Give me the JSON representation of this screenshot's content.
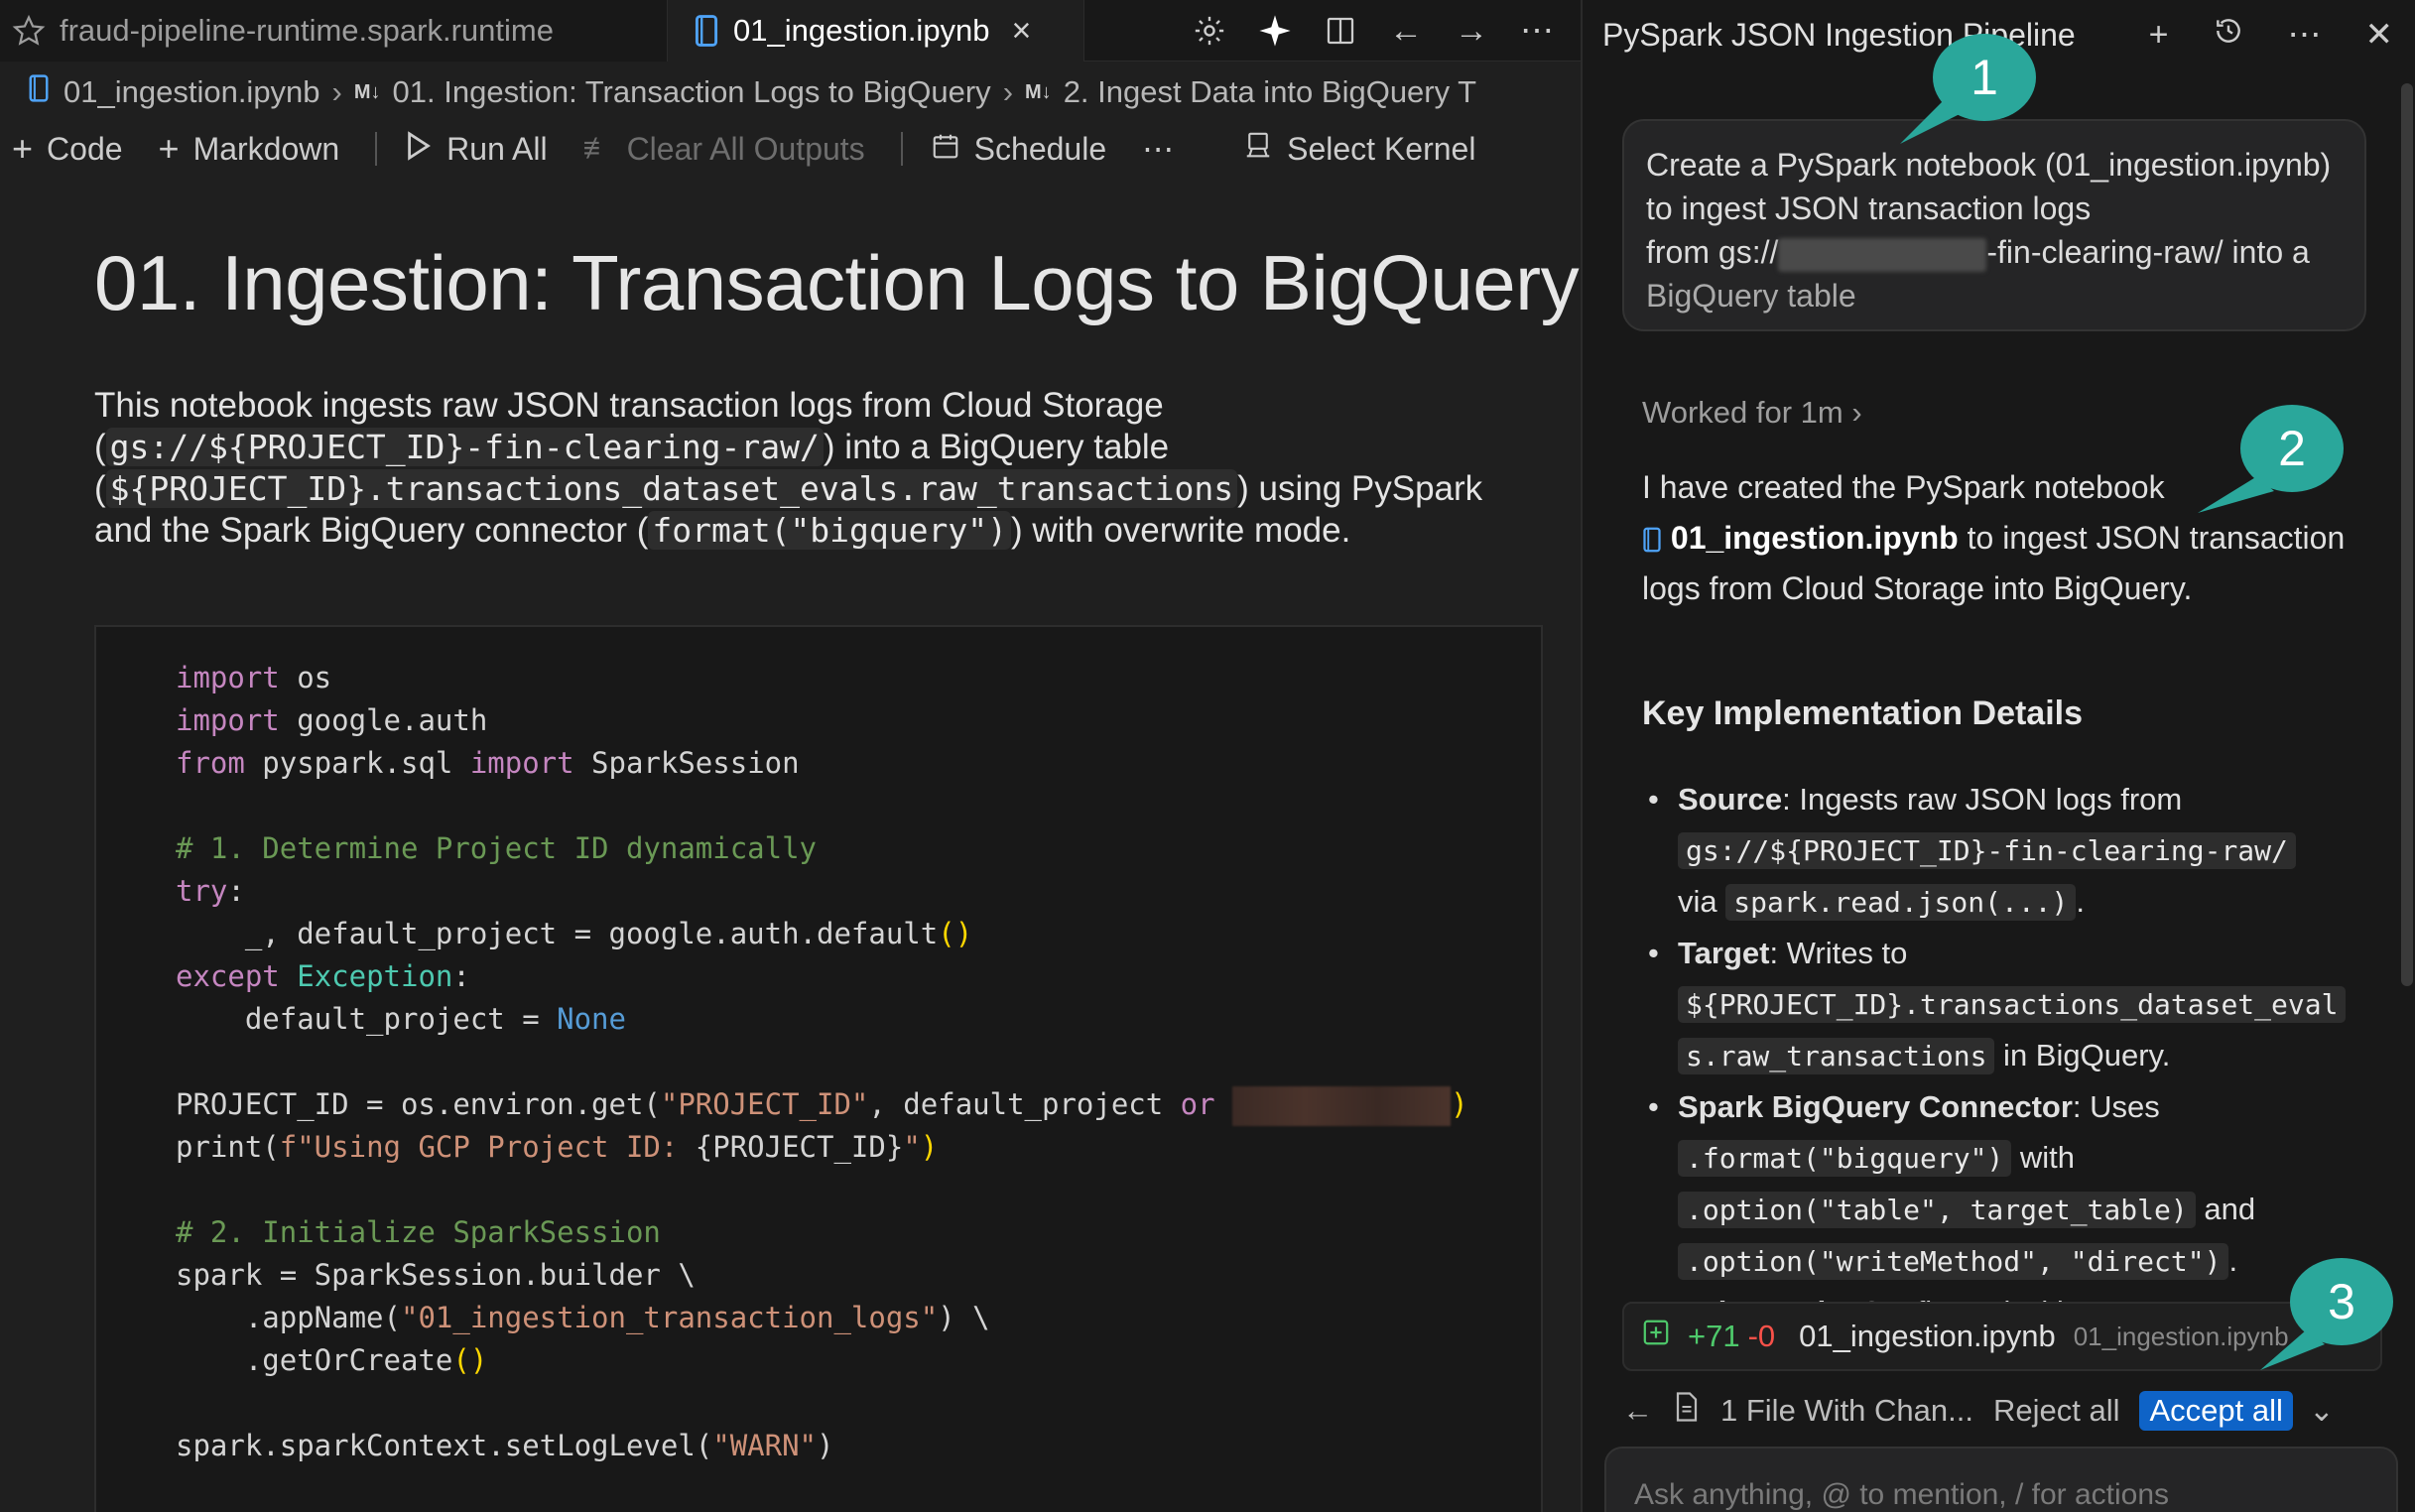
{
  "tabs": [
    {
      "label": "fraud-pipeline-runtime.spark.runtime"
    },
    {
      "label": "01_ingestion.ipynb"
    }
  ],
  "breadcrumb": {
    "file": "01_ingestion.ipynb",
    "md_tag": "M↓",
    "section1": "01. Ingestion: Transaction Logs to BigQuery",
    "section2": "2. Ingest Data into BigQuery T"
  },
  "toolbar": {
    "code": "Code",
    "markdown": "Markdown",
    "run_all": "Run All",
    "clear_outputs": "Clear All Outputs",
    "schedule": "Schedule",
    "more": "⋯",
    "select_kernel": "Select Kernel"
  },
  "notebook": {
    "title": "01. Ingestion: Transaction Logs to BigQuery",
    "desc_1": "This notebook ingests raw JSON transaction logs from Cloud Storage",
    "desc_code1": "gs://${PROJECT_ID}-fin-clearing-raw/",
    "desc_2": " into a BigQuery table",
    "desc_code2": "${PROJECT_ID}.transactions_dataset_evals.raw_transactions",
    "desc_3": " using PySpark",
    "desc_4": "and the Spark BigQuery connector (",
    "desc_code3": "format(\"bigquery\")",
    "desc_5": ") with overwrite mode."
  },
  "code": {
    "l1_kw": "import",
    "l1": " os",
    "l2_kw": "import",
    "l2": " google.auth",
    "l3_kw1": "from",
    "l3a": " pyspark.sql ",
    "l3_kw2": "import",
    "l3b": " SparkSession",
    "l5": "# 1. Determine Project ID dynamically",
    "l6_kw": "try",
    "l7": "_, default_project = google.auth.default",
    "l8_kw": "except",
    "l8_ty": "Exception",
    "l9a": "default_project = ",
    "l9_none": "None",
    "l11a": "PROJECT_ID = os.environ.get(",
    "l11_str": "\"PROJECT_ID\"",
    "l11b": ", default_project ",
    "l11_or": "or",
    "l12a": "print(",
    "l12_str1": "f\"Using GCP Project ID: ",
    "l12_var": "{PROJECT_ID}",
    "l12_str2": "\"",
    "l14": "# 2. Initialize SparkSession",
    "l15": "spark = SparkSession.builder \\",
    "l16a": ".appName(",
    "l16_str": "\"01_ingestion_transaction_logs\"",
    "l16b": ") \\",
    "l17": ".getOrCreate",
    "l19a": "spark.sparkContext.setLogLevel(",
    "l19_str": "\"WARN\""
  },
  "panel": {
    "title": "PySpark JSON Ingestion Pipeline",
    "user_msg_1": "Create a PySpark notebook (01_ingestion.ipynb) to ingest JSON transaction logs",
    "user_msg_2a": "from gs://",
    "user_msg_2b": "-fin-clearing-raw/ into a",
    "user_msg_3": "BigQuery table",
    "worked": "Worked for 1m",
    "resp_1": "I have created the PySpark notebook",
    "resp_file": "01_ingestion.ipynb",
    "resp_2": " to ingest JSON transaction logs from Cloud Storage into BigQuery.",
    "kid_title": "Key Implementation Details",
    "d1_label": "Source",
    "d1_text": ": Ingests raw JSON logs from",
    "d1_code1": "gs://${PROJECT_ID}-fin-clearing-raw/",
    "d1_via": "via ",
    "d1_code2": "spark.read.json(...)",
    "d2_label": "Target",
    "d2_text": ": Writes to",
    "d2_code1": "${PROJECT_ID}.transactions_dataset_eval",
    "d2_code2": "s.raw_transactions",
    "d2_tail": " in BigQuery.",
    "d3_label": "Spark BigQuery Connector",
    "d3_text": ": Uses",
    "d3_code1": ".format(\"bigquery\")",
    "d3_with": " with",
    "d3_code2": ".option(\"table\", target_table)",
    "d3_and": " and",
    "d3_code3": ".option(\"writeMethod\", \"direct\")",
    "d4_label": "Write Mode",
    "d4_text": ": Configured with",
    "file_add": "+71",
    "file_del": "-0",
    "file_name": "01_ingestion.ipynb",
    "file_path": "01_ingestion.ipynb",
    "changes": "1 File With Chan...",
    "reject_all": "Reject all",
    "accept_all": "Accept all",
    "input_placeholder": "Ask anything, @ to mention, / for actions"
  },
  "callouts": [
    "1",
    "2",
    "3"
  ],
  "colors": {
    "callout": "#2aa79b",
    "accept": "#0e63c7",
    "keyword": "#c586c0",
    "comment": "#6a9955",
    "string": "#ce9178"
  }
}
